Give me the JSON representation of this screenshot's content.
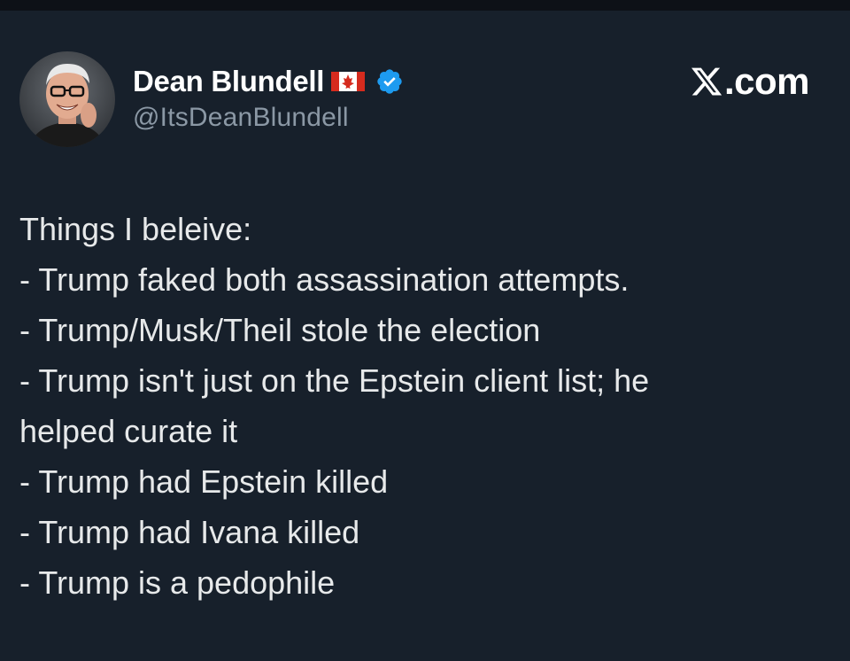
{
  "author": {
    "display_name": "Dean Blundell",
    "handle": "@ItsDeanBlundell",
    "flag_icon": "canada-flag-icon",
    "verified_icon": "verified-badge-icon",
    "verified_color": "#1d9bf0"
  },
  "brand": {
    "label": ".com",
    "icon": "x-logo-icon"
  },
  "tweet": {
    "lines": [
      "Things I beleive:",
      "- Trump faked both assassination attempts.",
      "- Trump/Musk/Theil stole the election",
      "- Trump isn't just on the Epstein client list; he",
      "helped curate it",
      "- Trump had Epstein killed",
      "- Trump had Ivana killed",
      "- Trump is a pedophile"
    ]
  },
  "colors": {
    "background": "#17202b",
    "text": "#e7e9ea",
    "secondary_text": "#8b98a5",
    "flag_red": "#d52b1e"
  }
}
